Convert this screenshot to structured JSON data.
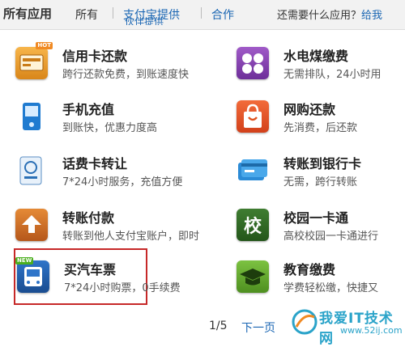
{
  "header": {
    "title": "所有应用",
    "tabs": [
      {
        "label": "所有"
      },
      {
        "label": "支付宝提供"
      },
      {
        "label": "合作"
      }
    ],
    "tab_subtext": "伙伴提供",
    "question_prefix": "还需要什么应用？",
    "question_link": "给我"
  },
  "apps": [
    {
      "name": "信用卡还款",
      "desc": "跨行还款免费，到账速度快",
      "badge": "HOT",
      "icon": "credit-card-icon"
    },
    {
      "name": "水电煤缴费",
      "desc": "无需排队，24小时用",
      "icon": "utility-payment-icon"
    },
    {
      "name": "手机充值",
      "desc": "到账快，优惠力度高",
      "icon": "mobile-phone-icon"
    },
    {
      "name": "网购还款",
      "desc": "先消费，后还款",
      "icon": "shopping-bag-icon"
    },
    {
      "name": "话费卡转让",
      "desc": "7*24小时服务，充值方便",
      "icon": "phone-card-icon"
    },
    {
      "name": "转账到银行卡",
      "desc": "无需，跨行转账",
      "icon": "bank-card-icon"
    },
    {
      "name": "转账付款",
      "desc": "转账到他人支付宝账户，即时",
      "icon": "transfer-icon"
    },
    {
      "name": "校园一卡通",
      "desc": "高校校园一卡通进行",
      "icon": "campus-card-icon",
      "icon_text": "校"
    },
    {
      "name": "买汽车票",
      "desc": "7*24小时购票，0手续费",
      "badge": "NEW",
      "icon": "bus-ticket-icon"
    },
    {
      "name": "教育缴费",
      "desc": "学费轻松缴，快捷又",
      "icon": "graduation-cap-icon"
    }
  ],
  "pager": {
    "page": "1/5",
    "next": "下一页"
  },
  "watermark": {
    "text": "我爱IT技术网",
    "url": "www.52ij.com"
  },
  "colors": {
    "link": "#1a66b3",
    "highlight": "#c62828"
  }
}
